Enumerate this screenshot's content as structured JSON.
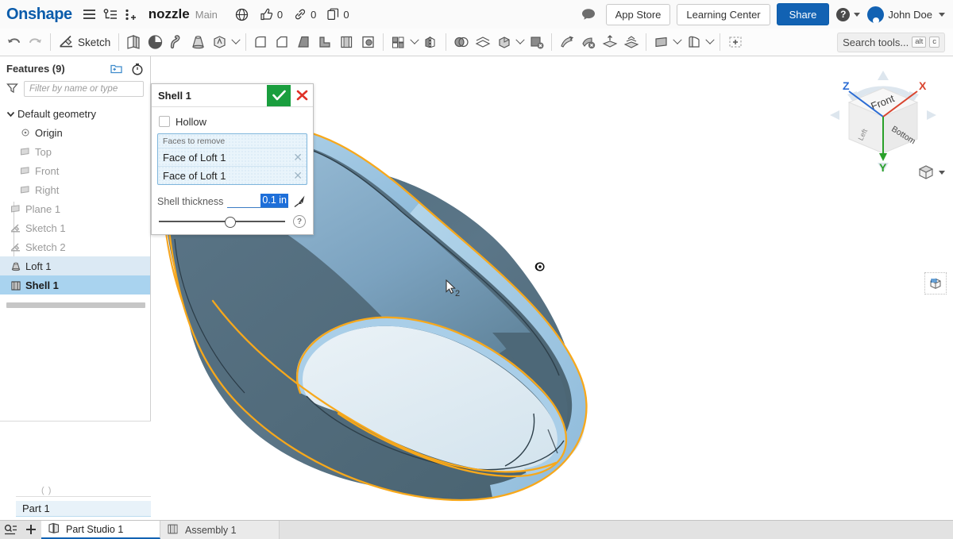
{
  "app": {
    "brand": "Onshape",
    "document_name": "nozzle",
    "workspace": "Main"
  },
  "topbar": {
    "menu_icon": "hamburger-icon",
    "versions_icon": "version-graph-icon",
    "insert_icon": "insert-feature-icon",
    "globe_icon": "globe-icon",
    "like_icon": "thumbs-up-icon",
    "like_count": "0",
    "link_icon": "link-icon",
    "link_count": "0",
    "copy_icon": "copy-icon",
    "copy_count": "0",
    "comment_icon": "comment-icon",
    "app_store_label": "App Store",
    "learning_center_label": "Learning Center",
    "share_label": "Share",
    "help_label": "?",
    "user_name": "John Doe",
    "share_color": "#1262b3",
    "brand_color": "#0b5cab"
  },
  "toolbar": {
    "undo_icon": "undo-icon",
    "redo_icon": "redo-icon",
    "sketch_label": "Sketch",
    "sketch_icon": "sketch-pencil-icon",
    "tools": [
      {
        "name": "extrude-icon"
      },
      {
        "name": "revolve-icon"
      },
      {
        "name": "sweep-icon"
      },
      {
        "name": "loft-icon"
      },
      {
        "name": "more-create-icon"
      },
      {
        "name": "fillet-icon"
      },
      {
        "name": "chamfer-icon"
      },
      {
        "name": "draft-icon"
      },
      {
        "name": "rib-icon"
      },
      {
        "name": "shell-icon"
      },
      {
        "name": "hole-icon"
      },
      {
        "name": "pattern-icon"
      },
      {
        "name": "mirror-icon"
      },
      {
        "name": "boolean-icon"
      },
      {
        "name": "split-icon"
      },
      {
        "name": "transform-icon"
      },
      {
        "name": "delete-face-icon"
      },
      {
        "name": "move-face-icon"
      },
      {
        "name": "replace-face-icon"
      },
      {
        "name": "import-derived-icon"
      },
      {
        "name": "export-icon"
      },
      {
        "name": "plane-icon"
      },
      {
        "name": "sheet-metal-icon"
      },
      {
        "name": "variable-icon"
      }
    ],
    "search_placeholder": "Search tools...",
    "search_kbd_1": "alt",
    "search_kbd_2": "c"
  },
  "features_panel": {
    "title": "Features (9)",
    "new_folder_icon": "new-folder-icon",
    "rollback_icon": "history-timer-icon",
    "filter_icon": "funnel-filter-icon",
    "filter_placeholder": "Filter by name or type",
    "feature_list_icon": "feature-list-icon",
    "tree": [
      {
        "label": "Default geometry",
        "icon": "chevron-down-icon",
        "level": 0,
        "state": "normal"
      },
      {
        "label": "Origin",
        "icon": "origin-icon",
        "level": 1,
        "state": "normal"
      },
      {
        "label": "Top",
        "icon": "plane-icon",
        "level": 1,
        "state": "dim"
      },
      {
        "label": "Front",
        "icon": "plane-icon",
        "level": 1,
        "state": "dim"
      },
      {
        "label": "Right",
        "icon": "plane-icon",
        "level": 1,
        "state": "dim"
      },
      {
        "label": "Plane 1",
        "icon": "plane-icon",
        "level": 0,
        "state": "dim"
      },
      {
        "label": "Sketch 1",
        "icon": "sketch-icon",
        "level": 0,
        "state": "dim"
      },
      {
        "label": "Sketch 2",
        "icon": "sketch-icon",
        "level": 0,
        "state": "dim"
      },
      {
        "label": "Loft 1",
        "icon": "loft-icon",
        "level": 0,
        "state": "selected"
      },
      {
        "label": "Shell 1",
        "icon": "shell-icon",
        "level": 0,
        "state": "active"
      }
    ]
  },
  "parts_panel": {
    "collapsed_marker": "( )",
    "items": [
      {
        "label": "Part 1"
      }
    ]
  },
  "shell_dialog": {
    "title": "Shell 1",
    "accept_icon": "checkmark-icon",
    "cancel_icon": "x-icon",
    "hollow_label": "Hollow",
    "hollow_checked": false,
    "faces_label": "Faces to remove",
    "faces": [
      {
        "label": "Face of Loft 1",
        "remove_icon": "x-icon"
      },
      {
        "label": "Face of Loft 1",
        "remove_icon": "x-icon"
      }
    ],
    "thickness_label": "Shell thickness",
    "thickness_value": "0.1 in",
    "thickness_selected": true,
    "measure_icon": "measure-pen-icon",
    "help_icon": "question-mark-icon",
    "slider_position_pct": 52,
    "accept_color": "#1a9e3e",
    "cancel_color": "#e03127",
    "selection_highlight": "#1e6fd9"
  },
  "viewport": {
    "view_cube": {
      "front_label": "Front",
      "bottom_label": "Bottom",
      "left_label": "Left",
      "axis_x": "X",
      "axis_y": "Y",
      "axis_z": "Z",
      "axis_x_color": "#d9452f",
      "axis_y_color": "#2aa02a",
      "axis_z_color": "#2b6cd4"
    },
    "view_home_icon": "view-home-cube-icon",
    "display_panel_icon": "display-state-icon",
    "cursor_badge": "2",
    "model": {
      "name": "lofted-nozzle-shell",
      "outer_face_color": "#55707f",
      "top_face_color": "#7ba7c7",
      "inner_face_color": "#dfeaf1",
      "rim_color": "#9cc6e0",
      "highlight_edge_color": "#f5a623"
    }
  },
  "bottom_tabs": {
    "search_icon": "tab-search-icon",
    "add_icon": "plus-icon",
    "tabs": [
      {
        "label": "Part Studio 1",
        "icon": "part-studio-icon",
        "active": true
      },
      {
        "label": "Assembly 1",
        "icon": "assembly-icon",
        "active": false
      }
    ]
  }
}
